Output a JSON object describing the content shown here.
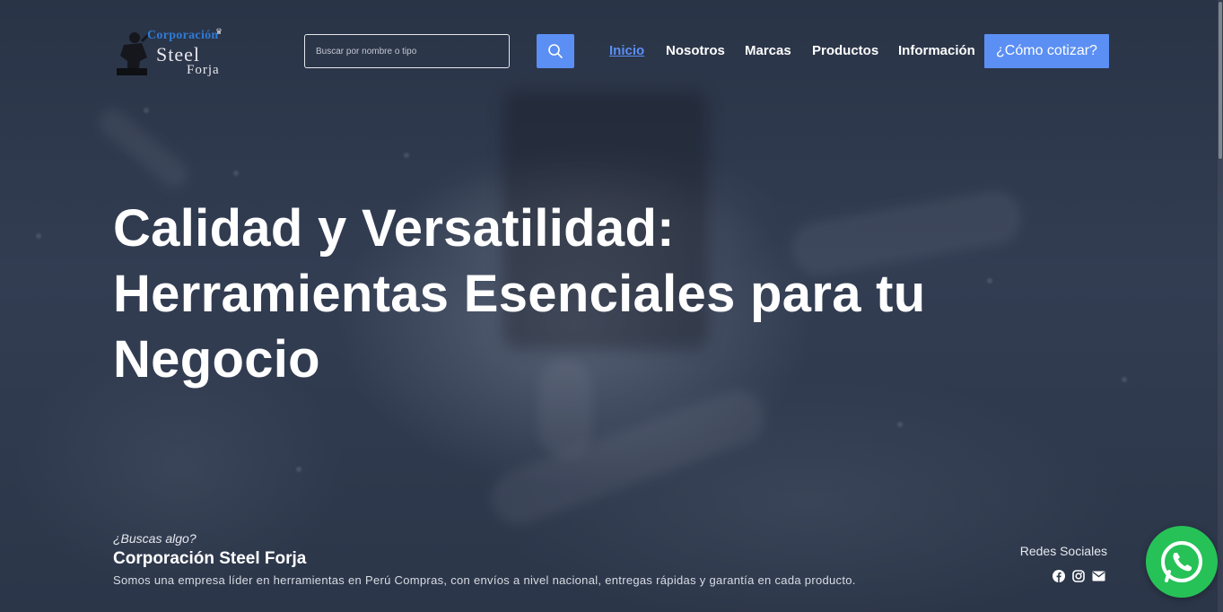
{
  "brand": {
    "logo_line1": "Corporación",
    "logo_line2": "Steel",
    "logo_line3": "Forja"
  },
  "search": {
    "placeholder": "Buscar por nombre o tipo",
    "value": "",
    "icon": "search-icon"
  },
  "nav": {
    "items": [
      {
        "label": "Inicio",
        "active": true
      },
      {
        "label": "Nosotros",
        "active": false
      },
      {
        "label": "Marcas",
        "active": false
      },
      {
        "label": "Productos",
        "active": false
      },
      {
        "label": "Información",
        "active": false
      }
    ],
    "cta_label": "¿Cómo cotizar?"
  },
  "hero": {
    "title_line1": "Calidad y Versatilidad:",
    "title_line2": "Herramientas Esenciales para tu",
    "title_line3": "Negocio"
  },
  "footer": {
    "question": "¿Buscas algo?",
    "company_name": "Corporación Steel Forja",
    "description": "Somos una empresa líder en herramientas en Perú Compras, con envíos a nivel nacional, entregas rápidas y garantía en cada producto.",
    "social_title": "Redes Sociales",
    "social_icons": [
      "facebook-icon",
      "instagram-icon",
      "mail-icon"
    ]
  },
  "whatsapp": {
    "icon": "whatsapp-icon"
  },
  "colors": {
    "accent": "#5b8ff3",
    "whatsapp": "#26c257",
    "background": "#2b3548"
  }
}
